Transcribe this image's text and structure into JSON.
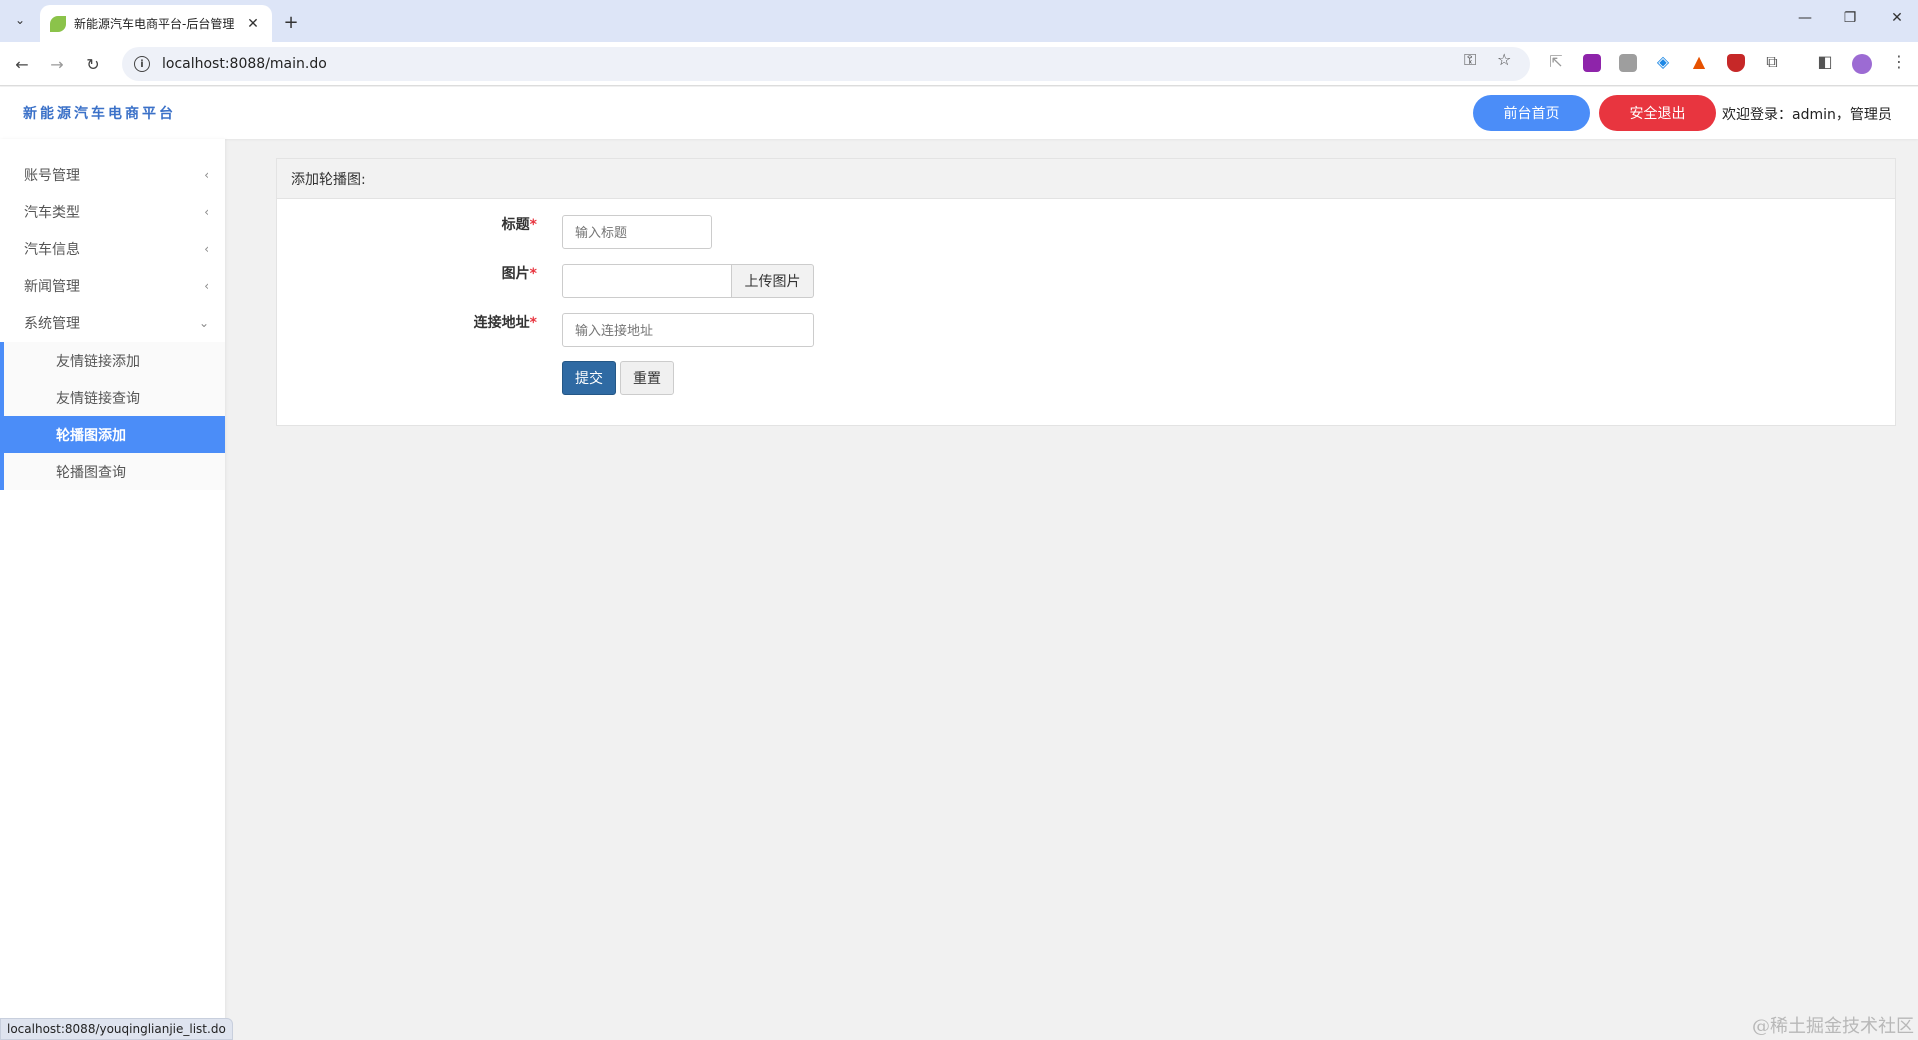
{
  "browser": {
    "tab_title": "新能源汽车电商平台-后台管理",
    "url": "localhost:8088/main.do",
    "status_url": "localhost:8088/youqinglianjie_list.do"
  },
  "header": {
    "brand": "新能源汽车电商平台",
    "home_btn": "前台首页",
    "logout_btn": "安全退出",
    "welcome": "欢迎登录：admin，管理员"
  },
  "sidebar": {
    "items": [
      {
        "label": "账号管理",
        "icon": "chevron-left-icon"
      },
      {
        "label": "汽车类型",
        "icon": "chevron-left-icon"
      },
      {
        "label": "汽车信息",
        "icon": "chevron-left-icon"
      },
      {
        "label": "新闻管理",
        "icon": "chevron-left-icon"
      },
      {
        "label": "系统管理",
        "icon": "chevron-down-icon"
      }
    ],
    "subitems": [
      {
        "label": "友情链接添加"
      },
      {
        "label": "友情链接查询"
      },
      {
        "label": "轮播图添加",
        "active": true
      },
      {
        "label": "轮播图查询"
      }
    ]
  },
  "form": {
    "heading": "添加轮播图:",
    "title_label": "标题",
    "title_placeholder": "输入标题",
    "image_label": "图片",
    "image_value": "",
    "upload_btn": "上传图片",
    "link_label": "连接地址",
    "link_placeholder": "输入连接地址",
    "required_mark": "*",
    "submit_btn": "提交",
    "reset_btn": "重置"
  },
  "watermark": "@稀土掘金技术社区",
  "colors": {
    "primary": "#4b8df8",
    "danger": "#e8353f",
    "submit": "#2f6aa3",
    "brand_text": "#3b71c8"
  }
}
